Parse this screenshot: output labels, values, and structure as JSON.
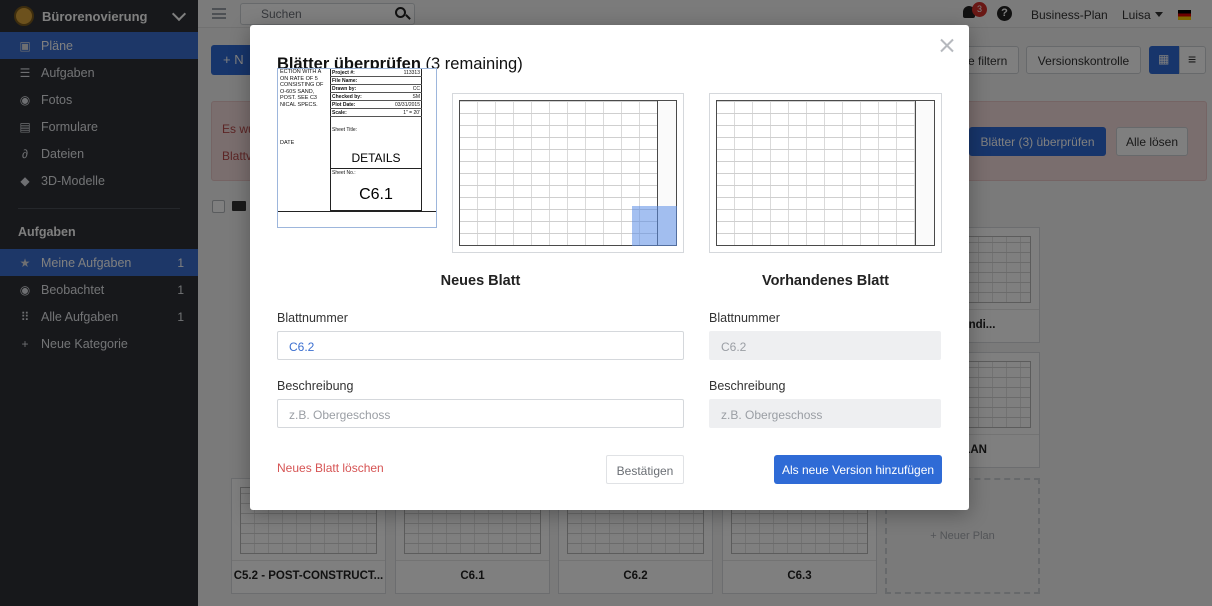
{
  "sidebar": {
    "project_name": "Bürorenovierung",
    "nav": [
      {
        "label": "Pläne",
        "icon": "plans-icon",
        "glyph": "▣"
      },
      {
        "label": "Aufgaben",
        "icon": "list-icon",
        "glyph": "☰"
      },
      {
        "label": "Fotos",
        "icon": "camera-icon",
        "glyph": "◉"
      },
      {
        "label": "Formulare",
        "icon": "clipboard-icon",
        "glyph": "▤"
      },
      {
        "label": "Dateien",
        "icon": "paperclip-icon",
        "glyph": "∂"
      },
      {
        "label": "3D-Modelle",
        "icon": "cube-icon",
        "glyph": "◆"
      }
    ],
    "tasks_heading": "Aufgaben",
    "tasks": [
      {
        "label": "Meine Aufgaben",
        "count": "1",
        "icon": "star-icon",
        "glyph": "★"
      },
      {
        "label": "Beobachtet",
        "count": "1",
        "icon": "eye-icon",
        "glyph": "◉"
      },
      {
        "label": "Alle Aufgaben",
        "count": "1",
        "icon": "grid-icon",
        "glyph": "⠿"
      },
      {
        "label": "Neue Kategorie",
        "count": "",
        "icon": "plus-icon",
        "glyph": "+"
      }
    ]
  },
  "topbar": {
    "search_placeholder": "Suchen",
    "notification_count": "3",
    "help": "?",
    "plan_label": "Business-Plan",
    "user_name": "Luisa"
  },
  "content": {
    "new_button": "+ N",
    "filter_button": "e filtern",
    "version_button": "Versionskontrolle",
    "alert_line1": "Es wu",
    "alert_line2": "Blattv",
    "review_button": "Blätter (3) überprüfen",
    "resolve_button": "Alle lösen",
    "cards": [
      {
        "label": "nde Kondi..."
      },
      {
        "label": "TY PLAN"
      },
      {
        "label": "C5.2 - POST-CONSTRUCT..."
      },
      {
        "label": "C6.1"
      },
      {
        "label": "C6.2"
      },
      {
        "label": "C6.3"
      }
    ],
    "add_plan": "+ Neuer Plan"
  },
  "modal": {
    "title_bold": "Blätter überprüfen",
    "title_rest": " (3 remaining)",
    "preview_detail": {
      "left_lines": [
        "ECTION WITH A",
        "ON RATE OF 5",
        "CONSISTING OF",
        "O-60S SAND,",
        "POST.  SEE C3",
        "NICAL SPECS."
      ],
      "rows": [
        {
          "label": "Project #:",
          "value": "113313"
        },
        {
          "label": "File Name:",
          "value": ""
        },
        {
          "label": "Drawn by:",
          "value": "CC"
        },
        {
          "label": "Checked by:",
          "value": "SM"
        },
        {
          "label": "Plot Date:",
          "value": "03/31/2015"
        },
        {
          "label": "Scale:",
          "value": "1\" = 20'"
        }
      ],
      "sheet_title_label": "Sheet Title:",
      "sheet_title": "DETAILS",
      "sheet_no_label": "Sheet No.:",
      "sheet_no": "C6.1",
      "date_label": "DATE"
    },
    "new_sheet_heading": "Neues Blatt",
    "existing_sheet_heading": "Vorhandenes Blatt",
    "new": {
      "number_label": "Blattnummer",
      "number_value": "C6.2",
      "description_label": "Beschreibung",
      "description_placeholder": "z.B. Obergeschoss"
    },
    "existing": {
      "number_label": "Blattnummer",
      "number_value": "C6.2",
      "description_label": "Beschreibung",
      "description_placeholder": "z.B. Obergeschoss"
    },
    "delete_link": "Neues Blatt löschen",
    "confirm_button": "Bestätigen",
    "new_version_button": "Als neue Version hinzufügen"
  }
}
